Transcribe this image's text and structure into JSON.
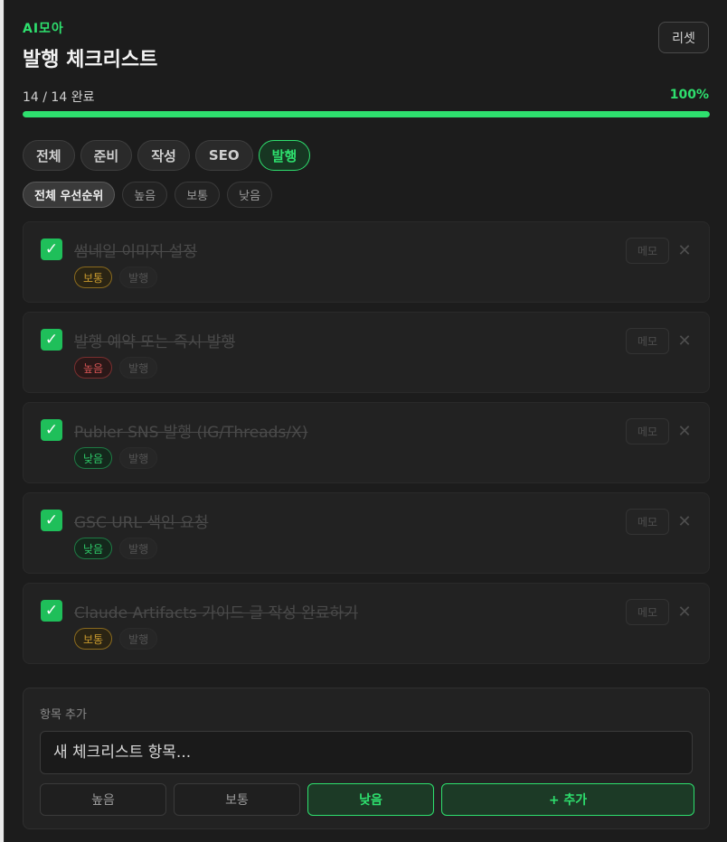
{
  "header": {
    "brand": "AI모아",
    "title": "발행 체크리스트",
    "reset_label": "리셋"
  },
  "progress": {
    "label": "14 / 14 완료",
    "percent_label": "100%",
    "fraction": 1.0
  },
  "category_tabs": [
    {
      "label": "전체",
      "active": false
    },
    {
      "label": "준비",
      "active": false
    },
    {
      "label": "작성",
      "active": false
    },
    {
      "label": "SEO",
      "active": false
    },
    {
      "label": "발행",
      "active": true
    }
  ],
  "priority_filters": [
    {
      "label": "전체 우선순위",
      "active": true
    },
    {
      "label": "높음",
      "active": false
    },
    {
      "label": "보통",
      "active": false
    },
    {
      "label": "낮음",
      "active": false
    }
  ],
  "items": [
    {
      "text": "썸네일 이미지 설정",
      "priority": "보통",
      "priority_level": "mid",
      "category": "발행",
      "checked": true,
      "memo_label": "메모",
      "delete_icon": "close-icon"
    },
    {
      "text": "발행 예약 또는 즉시 발행",
      "priority": "높음",
      "priority_level": "high",
      "category": "발행",
      "checked": true,
      "memo_label": "메모",
      "delete_icon": "close-icon"
    },
    {
      "text": "Publer SNS 발행 (IG/Threads/X)",
      "priority": "낮음",
      "priority_level": "low",
      "category": "발행",
      "checked": true,
      "memo_label": "메모",
      "delete_icon": "close-icon"
    },
    {
      "text": "GSC URL 색인 요청",
      "priority": "낮음",
      "priority_level": "low",
      "category": "발행",
      "checked": true,
      "memo_label": "메모",
      "delete_icon": "close-icon"
    },
    {
      "text": "Claude Artifacts 가이드 글 작성 완료하기",
      "priority": "보통",
      "priority_level": "mid",
      "category": "발행",
      "checked": true,
      "memo_label": "메모",
      "delete_icon": "close-icon"
    }
  ],
  "add_panel": {
    "label": "항목 추가",
    "input_placeholder": "새 체크리스트 항목...",
    "priority_buttons": [
      {
        "label": "높음",
        "active": false
      },
      {
        "label": "보통",
        "active": false
      },
      {
        "label": "낮음",
        "active": true
      }
    ],
    "submit_label": "+ 추가"
  },
  "colors": {
    "accent": "#2ee06e",
    "background": "#1c1c1c",
    "check": "#1fbf5a",
    "priority_high": "#d65454",
    "priority_mid": "#c99a2e",
    "priority_low": "#2ec868"
  }
}
